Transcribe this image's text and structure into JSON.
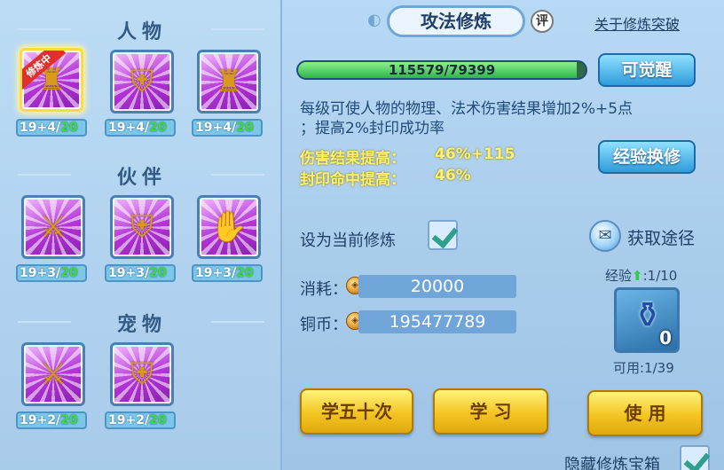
{
  "left": {
    "sections": [
      {
        "title": "人物",
        "items": [
          {
            "icon": "golden-warrior-glow-icon",
            "level": "19+4/",
            "cap": "20",
            "badge": "修炼中"
          },
          {
            "icon": "shield-warrior-icon",
            "level": "19+4/",
            "cap": "20"
          },
          {
            "icon": "helmet-warrior-icon",
            "level": "19+4/",
            "cap": "20"
          }
        ]
      },
      {
        "title": "伙伴",
        "items": [
          {
            "icon": "lion-sword-icon",
            "level": "19+3/",
            "cap": "20"
          },
          {
            "icon": "lion-shield-icon",
            "level": "19+3/",
            "cap": "20"
          },
          {
            "icon": "lion-glove-icon",
            "level": "19+3/",
            "cap": "20"
          }
        ]
      },
      {
        "title": "宠物",
        "items": [
          {
            "icon": "cat-sword-icon",
            "level": "19+2/",
            "cap": "20"
          },
          {
            "icon": "cat-shield-icon",
            "level": "19+2/",
            "cap": "20"
          }
        ]
      }
    ]
  },
  "header": {
    "title": "攻法修炼",
    "rating": "评",
    "link": "关于修炼突破"
  },
  "progress": {
    "text": "115579/79399",
    "fraction": 0.97
  },
  "buttons": {
    "awaken": "可觉醒",
    "exchange": "经验换修",
    "learn_fifty": "学五十次",
    "learn": "学 习",
    "use": "使 用"
  },
  "description": {
    "line1": "每级可使人物的物理、法术伤害结果增加2%+5点",
    "line2": "；提高2%封印成功率"
  },
  "effects": [
    {
      "label": "伤害结果提高：",
      "value": "46%+115"
    },
    {
      "label": "封印命中提高：",
      "value": "46%"
    }
  ],
  "set_current": {
    "label": "设为当前修炼",
    "checked": true
  },
  "acquire": {
    "label": "获取途径"
  },
  "cost": {
    "label": "消耗：",
    "value": "20000"
  },
  "coins": {
    "label": "铜币：",
    "value": "195477789"
  },
  "item": {
    "exp_label": "经验",
    "exp_value": ":1/10",
    "count": "0",
    "available": "可用:1/39"
  },
  "hide_box": {
    "label": "隐藏修炼宝箱",
    "checked": true
  },
  "colors": {
    "accent_gold": "#f3c523",
    "accent_blue": "#2f9cdb",
    "effect_yellow": "#fff16a",
    "cap_green": "#3ddc3d"
  }
}
